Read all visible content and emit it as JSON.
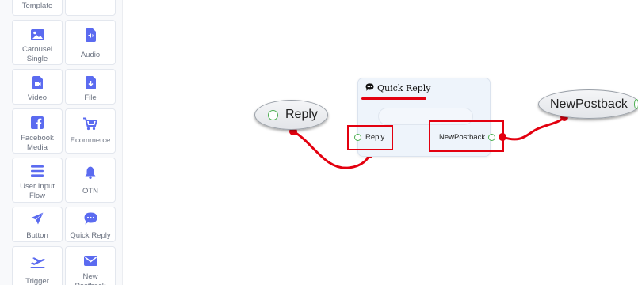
{
  "palette": {
    "items": [
      {
        "label": "Template",
        "icon": "template-icon"
      },
      {
        "label": "",
        "icon": ""
      },
      {
        "label": "Carousel\nSingle",
        "icon": "image-icon"
      },
      {
        "label": "Audio",
        "icon": "audio-file-icon"
      },
      {
        "label": "Video",
        "icon": "video-file-icon"
      },
      {
        "label": "File",
        "icon": "download-file-icon"
      },
      {
        "label": "Facebook\nMedia",
        "icon": "facebook-icon"
      },
      {
        "label": "Ecommerce",
        "icon": "cart-icon"
      },
      {
        "label": "User Input\nFlow",
        "icon": "menu-lines-icon"
      },
      {
        "label": "OTN",
        "icon": "bell-icon"
      },
      {
        "label": "Button",
        "icon": "paper-plane-icon"
      },
      {
        "label": "Quick Reply",
        "icon": "chat-bubble-icon"
      },
      {
        "label": "Trigger",
        "icon": "airplane-icon"
      },
      {
        "label": "New\nPostback",
        "icon": "envelope-icon"
      }
    ]
  },
  "canvas": {
    "reply_node": {
      "label": "Reply"
    },
    "newpostback_node": {
      "label": "NewPostback"
    },
    "quick_reply_node": {
      "title": "Quick Reply",
      "input_label": "Reply",
      "output_label": "NewPostback"
    }
  },
  "colors": {
    "accent_icon": "#5b6bf0",
    "highlight_red": "#e3000f",
    "port_green": "#4caf50"
  }
}
